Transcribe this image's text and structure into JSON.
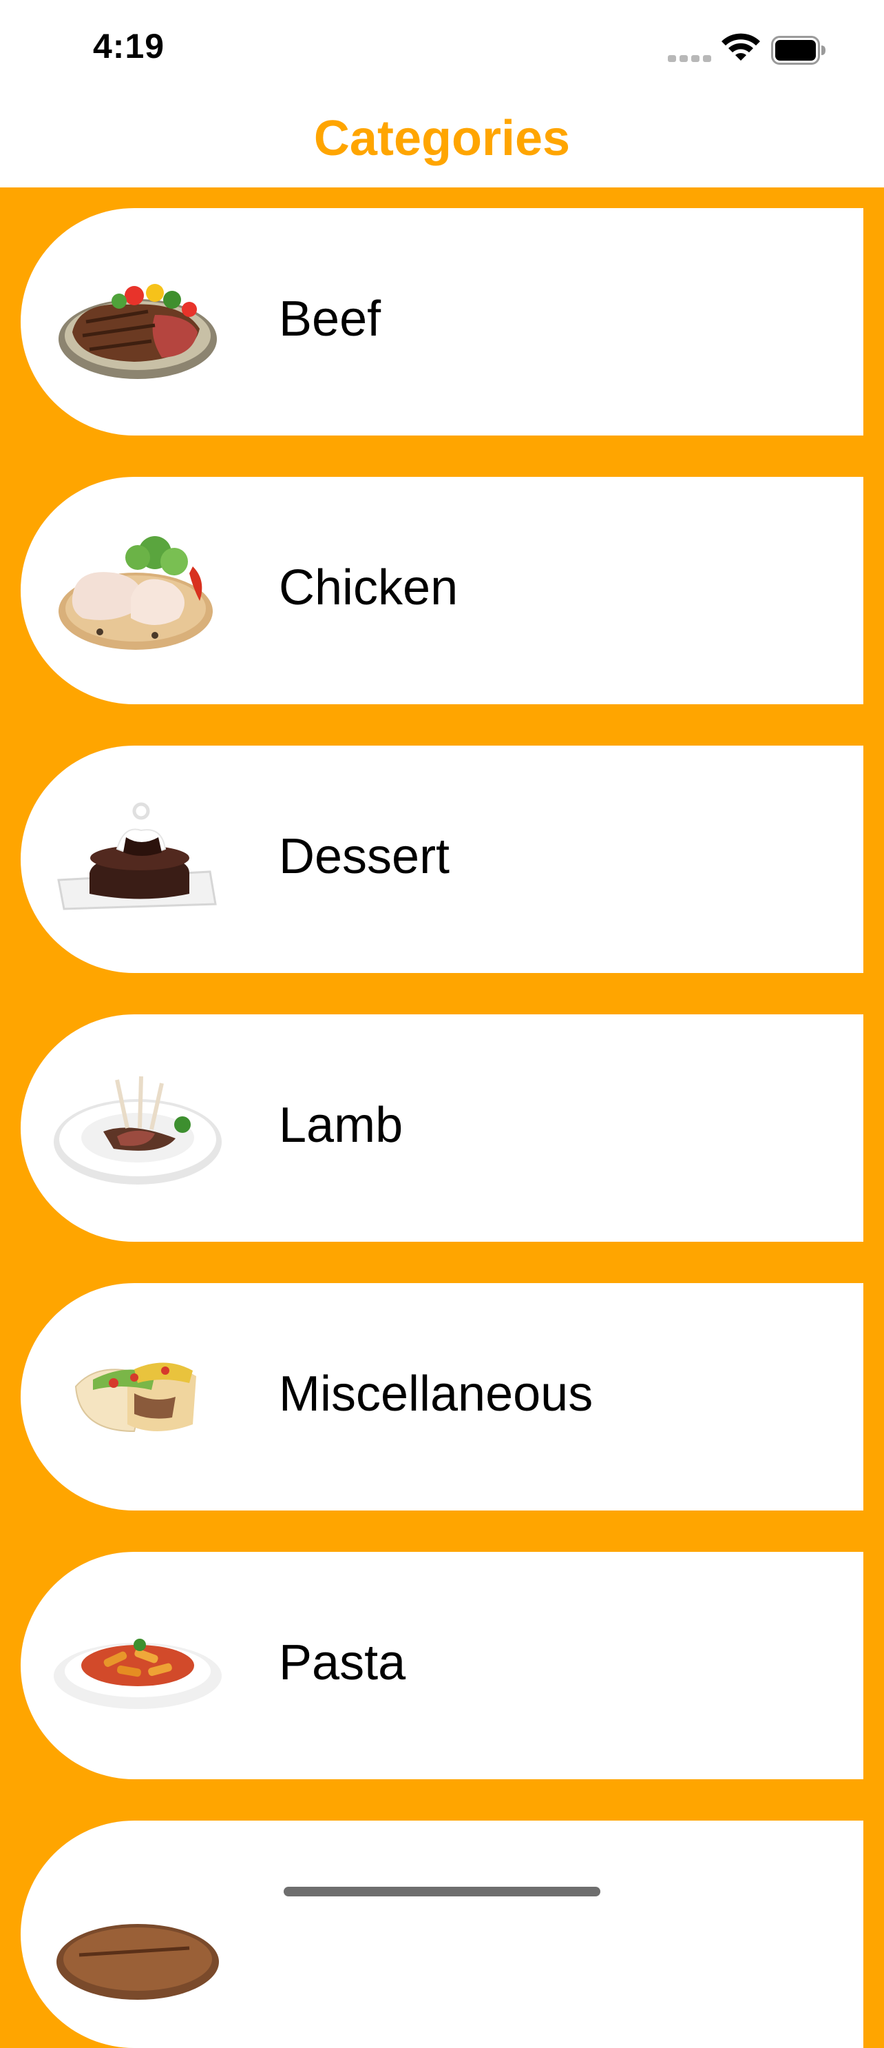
{
  "status_bar": {
    "time": "4:19",
    "icons": [
      "signal-icon",
      "wifi-icon",
      "battery-icon"
    ]
  },
  "nav": {
    "title": "Categories"
  },
  "colors": {
    "accent": "#FFA500",
    "card": "#FFFFFF",
    "text": "#000000"
  },
  "categories": [
    {
      "label": "Beef",
      "image": "beef-steak-image"
    },
    {
      "label": "Chicken",
      "image": "chicken-legs-image"
    },
    {
      "label": "Dessert",
      "image": "chocolate-cake-image"
    },
    {
      "label": "Lamb",
      "image": "lamb-rack-image"
    },
    {
      "label": "Miscellaneous",
      "image": "tacos-image"
    },
    {
      "label": "Pasta",
      "image": "penne-pasta-image"
    },
    {
      "label": "",
      "image": "pork-image"
    }
  ]
}
